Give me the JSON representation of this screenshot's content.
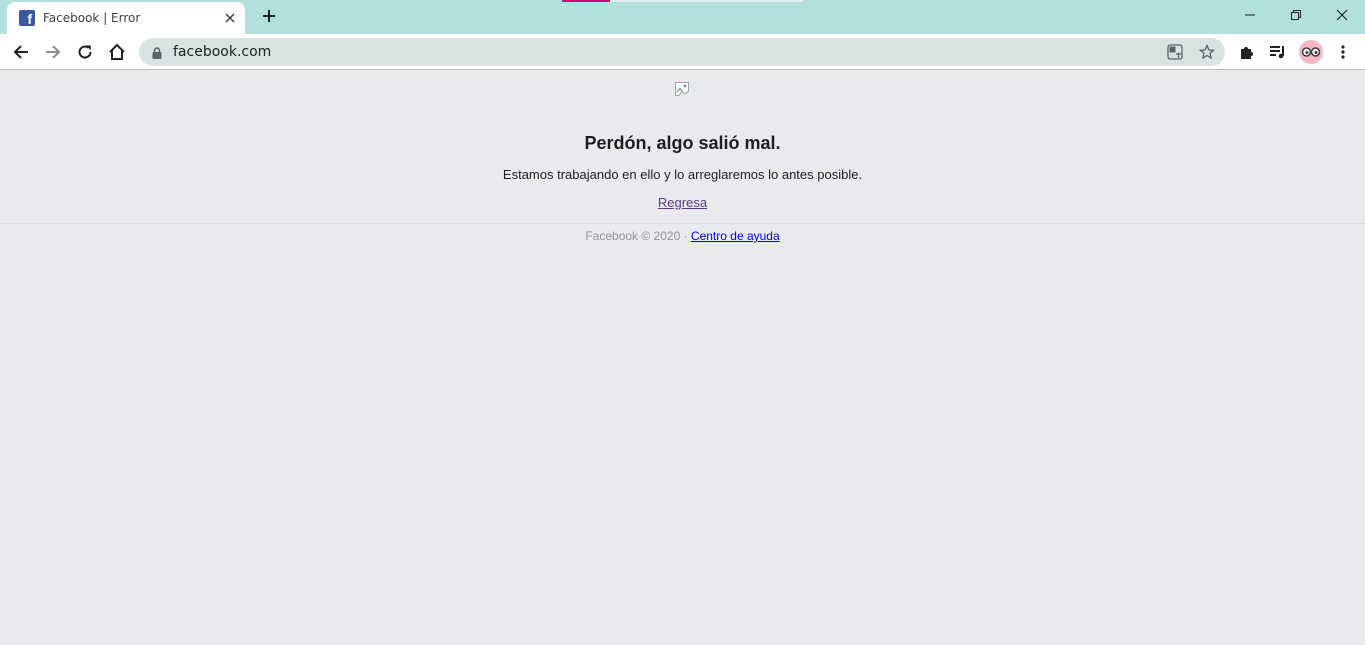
{
  "browser": {
    "tab": {
      "title": "Facebook | Error",
      "favicon": "facebook-favicon"
    },
    "address_bar": {
      "url": "facebook.com"
    },
    "colors": {
      "tabstrip": "#b2e0df",
      "omnibox": "#d8e2e1"
    }
  },
  "page": {
    "headline": "Perdón, algo salió mal.",
    "message": "Estamos trabajando en ello y lo arreglaremos lo antes posible.",
    "back_link": "Regresa",
    "footer": {
      "copyright": "Facebook © 2020 · ",
      "help_link": "Centro de ayuda"
    }
  }
}
